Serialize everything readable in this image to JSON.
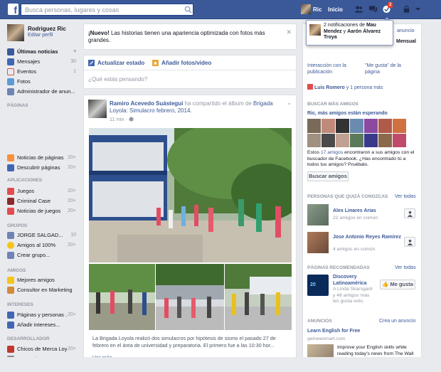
{
  "topbar": {
    "search_placeholder": "Busca personas, lugares y cosas",
    "user_name": "Ric",
    "home_label": "Inicio",
    "notif_count": "2"
  },
  "notification": {
    "prefix": "2 notificaciones de ",
    "names": "Mau Mendez",
    "conj": " y ",
    "names2": "Aarón Álvarez Troya"
  },
  "left": {
    "profile_name": "Rodriguez Ric",
    "profile_edit": "Editar perfil",
    "favorites": [
      {
        "label": "Últimas noticias",
        "count": "▾"
      },
      {
        "label": "Mensajes",
        "count": "30"
      },
      {
        "label": "Eventos",
        "count": "1"
      },
      {
        "label": "Fotos",
        "count": ""
      },
      {
        "label": "Administrador de anun...",
        "count": ""
      }
    ],
    "pages_header": "PÁGINAS",
    "pages": [
      {
        "label": "Noticias de páginas",
        "count": "20+"
      },
      {
        "label": "Descubrir páginas",
        "count": "20+"
      }
    ],
    "apps_header": "APLICACIONES",
    "apps": [
      {
        "label": "Juegos",
        "count": "20+"
      },
      {
        "label": "Criminal Case",
        "count": "20+"
      },
      {
        "label": "Noticias de juegos",
        "count": "20+"
      }
    ],
    "groups_header": "GRUPOS",
    "groups": [
      {
        "label": "JORGE SALGAD...",
        "count": "10"
      },
      {
        "label": "Amigos al 100%",
        "count": "20+"
      },
      {
        "label": "Crear grupo...",
        "count": ""
      }
    ],
    "friends_header": "AMIGOS",
    "friends": [
      {
        "label": "Mejores amigos",
        "count": ""
      },
      {
        "label": "Consultor en Marketing",
        "count": ""
      }
    ],
    "interests_header": "INTERESES",
    "interests": [
      {
        "label": "Páginas y personas ...",
        "count": "20+"
      },
      {
        "label": "Añadir intereses...",
        "count": ""
      }
    ],
    "dev_header": "DESARROLLADOR",
    "dev": [
      {
        "label": "Chicos de Merca Loyo...",
        "count": "20+"
      },
      {
        "label": "Crear Ideo...",
        "count": ""
      }
    ]
  },
  "nuevo": {
    "bold": "¡Nuevo!",
    "text": " Las historias tienen una apariencia optimizada con fotos más grandes."
  },
  "composer": {
    "status_tab": "Actualizar estado",
    "photo_tab": "Añadir fotos/video",
    "placeholder": "¿Qué estás pensando?"
  },
  "post": {
    "author": "Ramiro Acevedo Suástegui",
    "action": " ha compartido el álbum de ",
    "page": "Brigada Loyola",
    "album": ": Simulacro febrero, 2014.",
    "time": "11 min · ",
    "caption": "La Brigada Loyola realizó dos simulacros por hipótesis de sismo el pasado 27 de febrero en el área de universidad y preparatoria. El primero fue a las 10:30 hor...",
    "more": "Ver más"
  },
  "right": {
    "anuncio_top": "anuncio",
    "mensual": "Mensual",
    "interaction": "Interacción con la publicación",
    "me_gusta_page": "\"Me gusta\" de la página",
    "friends_line": "Luis Romero",
    "friends_line2": " y 1 persona más",
    "search_header": "BUSCAR MÁS AMIGOS",
    "waiting": "Ric, más amigos están esperando",
    "found_text": "Estos ",
    "found_count": "17 amigos",
    "found_rest": " encontraron a sus amigos con el buscador de Facebook. ¿Has encontrado tú a todos tus amigos? Pruébalo.",
    "search_btn": "Buscar amigos",
    "pymk_header": "PERSONAS QUE QUIZÁ CONOZCAS",
    "see_all": "Ver todas",
    "pymk": [
      {
        "name": "Alex Linares Arias",
        "sub": "22 amigos en común"
      },
      {
        "name": "Jose Antonio Reyes Ramírez",
        "sub": "4 amigos en común"
      }
    ],
    "rec_header": "PÁGINAS RECOMENDADAS",
    "rec_see_all": "Ver todas",
    "rec_name": "Discovery Latinoamérica",
    "rec_sub": "A Linda Skarsgard y 46 amigos más les gusta esto.",
    "like_btn": "Me gusta",
    "ads_header": "ANUNCIOS",
    "create_ad": "Crea un anuncio",
    "ad_title": "Learn English for Free",
    "ad_domain": "gelnewsmart.com",
    "ad_text": "Improve your English skills while reading today's news from The Wall Street"
  }
}
